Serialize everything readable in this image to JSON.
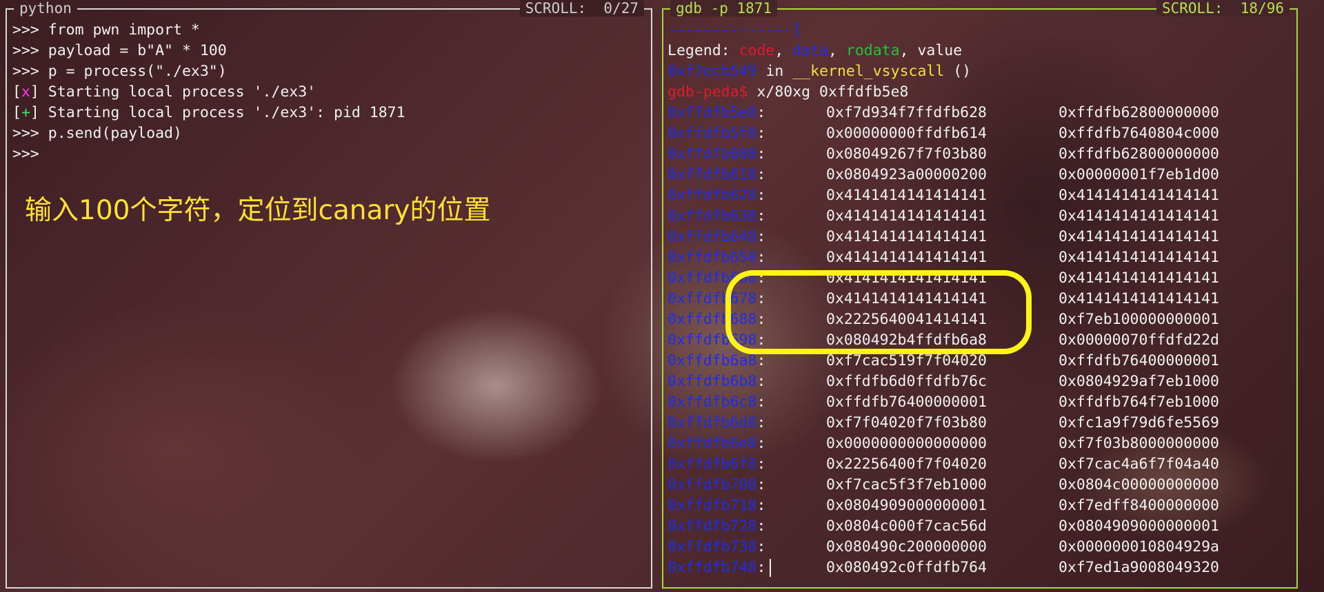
{
  "left_pane": {
    "title": "python",
    "scroll": "SCROLL:  0/27",
    "lines": [
      {
        "prompt": ">>> ",
        "text": "from pwn import *"
      },
      {
        "prompt": ">>> ",
        "text": "payload = b\"A\" * 100"
      },
      {
        "prompt": ">>> ",
        "text": "p = process(\"./ex3\")"
      }
    ],
    "log_lines": [
      {
        "open": "[",
        "mark": "x",
        "close": "]",
        "text": " Starting local process './ex3'"
      },
      {
        "open": "[",
        "mark": "+",
        "close": "]",
        "text": " Starting local process './ex3': pid 1871"
      }
    ],
    "tail_lines": [
      {
        "prompt": ">>> ",
        "text": "p.send(payload)"
      },
      {
        "prompt": ">>> ",
        "text": ""
      }
    ],
    "annotation": "输入100个字符，定位到canary的位置"
  },
  "right_pane": {
    "title": "gdb -p 1871",
    "scroll": "SCROLL:  18/96",
    "separator": "--------------]",
    "legend": {
      "label": "Legend: ",
      "code": "code",
      "data": "data",
      "rodata": "rodata",
      "value": "value",
      "sep": ", "
    },
    "frame": {
      "addr": "0xf7ecb549",
      "in": " in ",
      "func": "__kernel_vsyscall",
      "args": " ()"
    },
    "command": {
      "prompt": "gdb-peda$",
      "text": " x/80xg 0xffdfb5e8"
    },
    "memory_rows": [
      {
        "addr": "0xffdfb5e8",
        "v1": "0xf7d934f7ffdfb628",
        "v2": "0xffdfb62800000000"
      },
      {
        "addr": "0xffdfb5f8",
        "v1": "0x00000000ffdfb614",
        "v2": "0xffdfb7640804c000"
      },
      {
        "addr": "0xffdfb608",
        "v1": "0x08049267f7f03b80",
        "v2": "0xffdfb62800000000"
      },
      {
        "addr": "0xffdfb618",
        "v1": "0x0804923a00000200",
        "v2": "0x00000001f7eb1d00"
      },
      {
        "addr": "0xffdfb628",
        "v1": "0x4141414141414141",
        "v2": "0x4141414141414141"
      },
      {
        "addr": "0xffdfb638",
        "v1": "0x4141414141414141",
        "v2": "0x4141414141414141"
      },
      {
        "addr": "0xffdfb648",
        "v1": "0x4141414141414141",
        "v2": "0x4141414141414141"
      },
      {
        "addr": "0xffdfb658",
        "v1": "0x4141414141414141",
        "v2": "0x4141414141414141"
      },
      {
        "addr": "0xffdfb668",
        "v1": "0x4141414141414141",
        "v2": "0x4141414141414141"
      },
      {
        "addr": "0xffdfb678",
        "v1": "0x4141414141414141",
        "v2": "0x4141414141414141"
      },
      {
        "addr": "0xffdfb688",
        "v1": "0x2225640041414141",
        "v2": "0xf7eb100000000001"
      },
      {
        "addr": "0xffdfb698",
        "v1": "0x080492b4ffdfb6a8",
        "v2": "0x00000070ffdfd22d"
      },
      {
        "addr": "0xffdfb6a8",
        "v1": "0xf7cac519f7f04020",
        "v2": "0xffdfb76400000001"
      },
      {
        "addr": "0xffdfb6b8",
        "v1": "0xffdfb6d0ffdfb76c",
        "v2": "0x0804929af7eb1000"
      },
      {
        "addr": "0xffdfb6c8",
        "v1": "0xffdfb76400000001",
        "v2": "0xffdfb764f7eb1000"
      },
      {
        "addr": "0xffdfb6d8",
        "v1": "0xf7f04020f7f03b80",
        "v2": "0xfc1a9f79d6fe5569"
      },
      {
        "addr": "0xffdfb6e8",
        "v1": "0x0000000000000000",
        "v2": "0xf7f03b8000000000"
      },
      {
        "addr": "0xffdfb6f8",
        "v1": "0x22256400f7f04020",
        "v2": "0xf7cac4a6f7f04a40"
      },
      {
        "addr": "0xffdfb708",
        "v1": "0xf7cac5f3f7eb1000",
        "v2": "0x0804c00000000000"
      },
      {
        "addr": "0xffdfb718",
        "v1": "0x0804909000000001",
        "v2": "0xf7edff8400000000"
      },
      {
        "addr": "0xffdfb728",
        "v1": "0x0804c000f7cac56d",
        "v2": "0x0804909000000001"
      },
      {
        "addr": "0xffdfb738",
        "v1": "0x080490c200000000",
        "v2": "0x000000010804929a"
      },
      {
        "addr": "0xffdfb748",
        "v1": "0x080492c0ffdfb764",
        "v2": "0xf7ed1a9008049320"
      }
    ]
  }
}
